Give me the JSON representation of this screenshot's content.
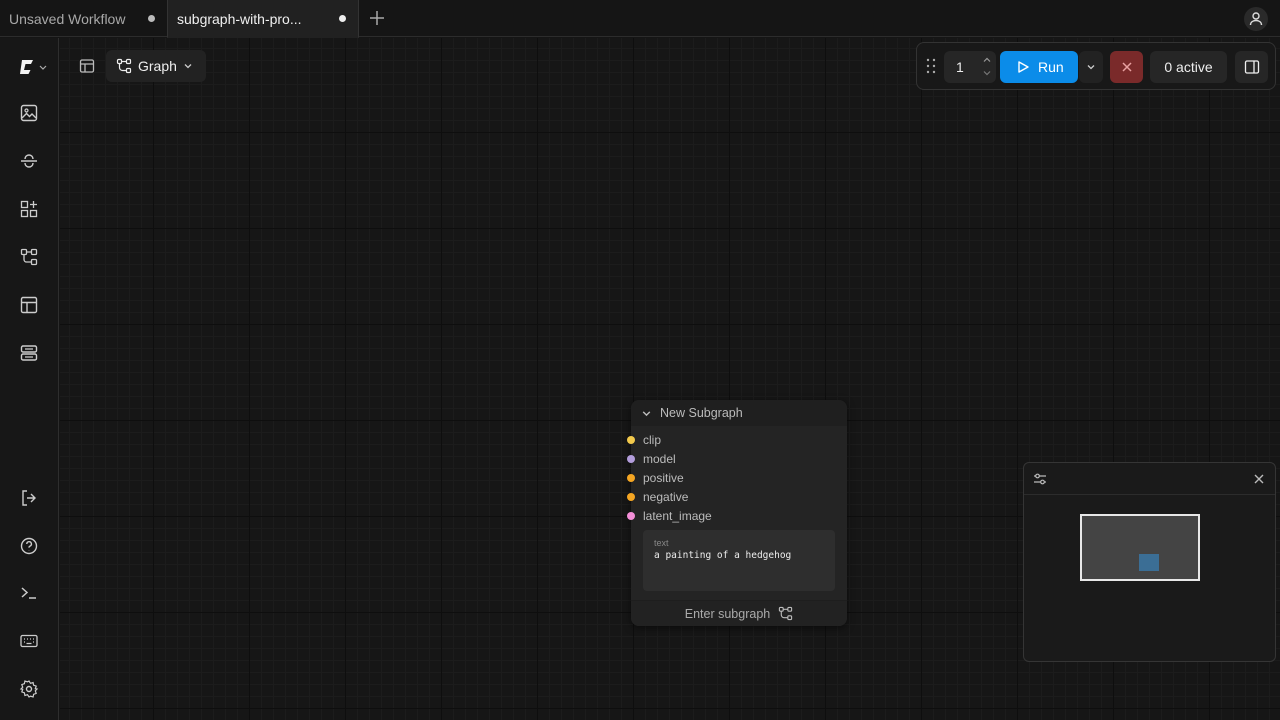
{
  "tabs": [
    {
      "label": "Unsaved Workflow",
      "modified": true
    },
    {
      "label": "subgraph-with-pro...",
      "modified": true,
      "active": true
    }
  ],
  "toolbar": {
    "view_mode_label": "Graph",
    "queue_count": "1",
    "run_label": "Run",
    "active_label": "0 active"
  },
  "node": {
    "title": "New Subgraph",
    "inputs": [
      {
        "name": "clip",
        "color": "#f2c94c"
      },
      {
        "name": "model",
        "color": "#b39ddb"
      },
      {
        "name": "positive",
        "color": "#f5a623"
      },
      {
        "name": "negative",
        "color": "#f5a623"
      },
      {
        "name": "latent_image",
        "color": "#f48fd8"
      }
    ],
    "widget": {
      "label": "text",
      "value": "a painting of a hedgehog"
    },
    "footer_label": "Enter subgraph"
  },
  "colors": {
    "accent": "#0b8ce9",
    "cancel": "#7a2a2a",
    "minimap_node": "#3b6e95"
  },
  "sidebar_icons": [
    "logo-icon",
    "images-icon",
    "models-icon",
    "nodes-icon",
    "workflows-icon",
    "templates-icon",
    "queue-icon",
    "logout-icon",
    "help-icon",
    "terminal-icon",
    "keyboard-icon",
    "settings-icon"
  ]
}
